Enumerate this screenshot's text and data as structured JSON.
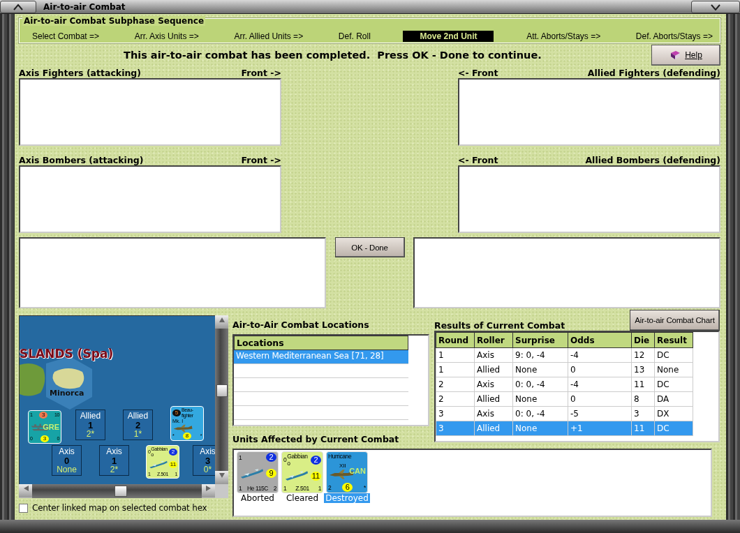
{
  "window": {
    "title": "Air-to-air Combat"
  },
  "subphase": {
    "title": "Air-to-air Combat Subphase Sequence",
    "steps": [
      {
        "label": "Select Combat =>",
        "selected": false
      },
      {
        "label": "Arr. Axis Units =>",
        "selected": false
      },
      {
        "label": "Arr. Allied Units =>",
        "selected": false
      },
      {
        "label": "Def. Roll",
        "selected": false
      },
      {
        "label": "Move 2nd Unit",
        "selected": true
      },
      {
        "label": "Att. Aborts/Stays =>",
        "selected": false
      },
      {
        "label": "Def. Aborts/Stays =>",
        "selected": false
      }
    ]
  },
  "message": "This air-to-air combat has been completed.  Press OK - Done to continue.",
  "help_button": "Help",
  "fighters": {
    "axis_label": "Axis Fighters (attacking)",
    "axis_front": "Front ->",
    "allied_front": "<- Front",
    "allied_label": "Allied Fighters (defending)"
  },
  "bombers": {
    "axis_label": "Axis Bombers (attacking)",
    "axis_front": "Front ->",
    "allied_front": "<- Front",
    "allied_label": "Allied Bombers (defending)"
  },
  "ok_button": "OK - Done",
  "map": {
    "region_label": "SLANDS (Spa)",
    "island_label": "Minorca",
    "stacks": [
      {
        "side": "Allied",
        "number": "1",
        "value": "2*"
      },
      {
        "side": "Allied",
        "number": "2",
        "value": "1*"
      },
      {
        "side": "Axis",
        "number": "0",
        "value": "None"
      },
      {
        "side": "Axis",
        "number": "1",
        "value": "2*"
      },
      {
        "side": "Axis",
        "number": "3",
        "value": "0*"
      }
    ],
    "counters": [
      {
        "kind": "ship",
        "color": "#17a3a6",
        "top": [
          {
            "text": "1"
          },
          {
            "text": "3",
            "color": "#f07a50"
          },
          {
            "text": "10"
          }
        ],
        "code": "GRE",
        "bottom": [
          {
            "text": "0"
          },
          {
            "text": "3",
            "color": "#ffff00"
          },
          {
            "text": "0"
          }
        ]
      },
      {
        "kind": "plane",
        "color": "#33a8e0",
        "top": [
          {
            "text": "5",
            "color": "#111111"
          },
          {
            "text": "Beau-fighter"
          }
        ],
        "subname": "Mk. I",
        "bottom": [
          {
            "text": "*"
          },
          {
            "text": "8",
            "color": "#ffff00"
          },
          {
            "text": "*"
          }
        ]
      },
      {
        "kind": "seaplane",
        "color": "#d9ee86",
        "top": [
          {
            "text": "0"
          },
          {
            "text": "Gabbiano"
          },
          {
            "text": "2",
            "color": "#1030e0"
          }
        ],
        "middle": [
          {
            "text": "11",
            "color": "#ffff00"
          }
        ],
        "bottom": [
          {
            "text": "1"
          },
          {
            "text": "Z.501"
          },
          {
            "text": "1"
          }
        ]
      }
    ]
  },
  "center_checkbox": {
    "label": "Center linked map on selected combat hex",
    "checked": false
  },
  "locations": {
    "title": "Air-to-Air Combat Locations",
    "column": "Locations",
    "items": [
      {
        "label": "Western Mediterranean Sea [71, 28]",
        "selected": true
      }
    ]
  },
  "results": {
    "title": "Results of Current Combat",
    "chart_button": "Air-to-air Combat Chart",
    "columns": [
      "Round",
      "Roller",
      "Surprise",
      "Odds",
      "Die",
      "Result"
    ],
    "rows": [
      {
        "cells": [
          "1",
          "Axis",
          "9: 0, -4",
          "-4",
          "12",
          "DC"
        ],
        "selected": false
      },
      {
        "cells": [
          "1",
          "Allied",
          "None",
          "0",
          "13",
          "None"
        ],
        "selected": false
      },
      {
        "cells": [
          "2",
          "Axis",
          "0: 0, -4",
          "-4",
          "11",
          "DC"
        ],
        "selected": false
      },
      {
        "cells": [
          "2",
          "Allied",
          "None",
          "0",
          "8",
          "DA"
        ],
        "selected": false
      },
      {
        "cells": [
          "3",
          "Axis",
          "0: 0, -4",
          "-5",
          "3",
          "DX"
        ],
        "selected": false
      },
      {
        "cells": [
          "3",
          "Allied",
          "None",
          "+1",
          "11",
          "DC"
        ],
        "selected": true
      }
    ]
  },
  "units": {
    "title": "Units Affected by Current Combat",
    "items": [
      {
        "status": "Aborted",
        "selected": false,
        "counter": {
          "kind": "seaplane",
          "color": "#a9a9a9",
          "top": [
            {
              "text": "1"
            },
            {
              "text": "2",
              "color": "#1030e0"
            }
          ],
          "middle": [
            {
              "text": "9",
              "color": "#ffff00"
            }
          ],
          "bottom": [
            {
              "text": "1"
            },
            {
              "text": "He 115C"
            },
            {
              "text": "2"
            }
          ]
        }
      },
      {
        "status": "Cleared",
        "selected": false,
        "counter": {
          "kind": "seaplane",
          "color": "#d9ee86",
          "top": [
            {
              "text": "0"
            },
            {
              "text": "Gabbiano"
            },
            {
              "text": "2",
              "color": "#1030e0"
            }
          ],
          "middle": [
            {
              "text": "11",
              "color": "#ffff00"
            }
          ],
          "bottom": [
            {
              "text": "1"
            },
            {
              "text": "Z.501"
            },
            {
              "text": "1"
            }
          ]
        }
      },
      {
        "status": "Destroyed",
        "selected": true,
        "counter": {
          "kind": "plane",
          "color": "#2c95d8",
          "top": [
            {
              "text": "Hurricane"
            }
          ],
          "subname": "XII",
          "code": "CAN",
          "bottom": [
            {
              "text": "2"
            },
            {
              "text": "6",
              "color": "#ffff00"
            },
            {
              "text": "*"
            }
          ]
        }
      }
    ]
  }
}
